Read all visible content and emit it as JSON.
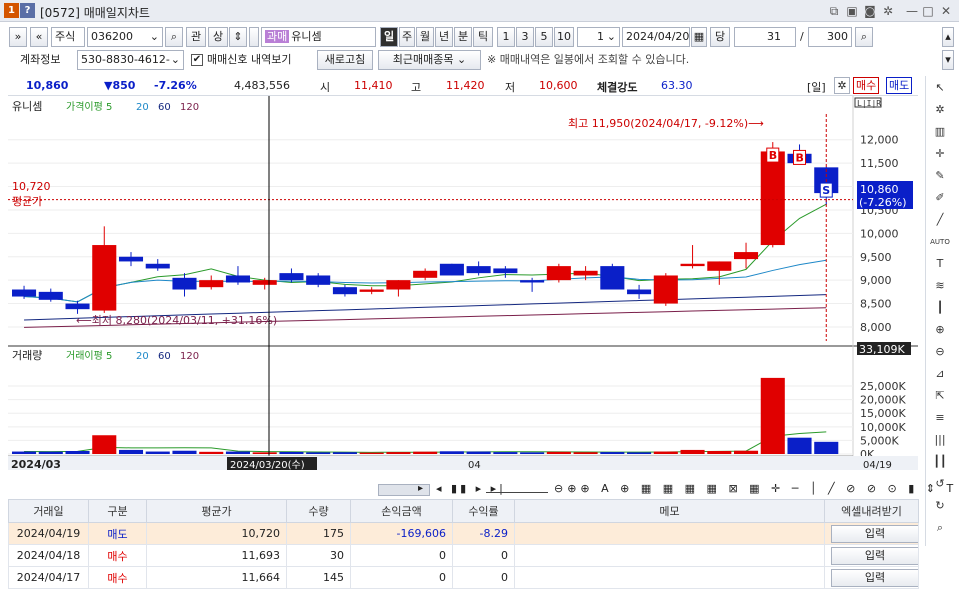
{
  "window": {
    "title": "[0572] 매매일지차트",
    "badge1": "1",
    "badge2": "?"
  },
  "toolbar": {
    "market": "주식",
    "code": "036200",
    "btn_search": "관",
    "btn_up": "상",
    "tax_tag": "과매",
    "stock_name": "유니셈",
    "periods": [
      "일",
      "주",
      "월",
      "년",
      "분",
      "틱"
    ],
    "nums": [
      "1",
      "3",
      "5",
      "10"
    ],
    "interval": "1",
    "date": "2024/04/20",
    "btn_today": "당",
    "count": "31",
    "slash": "/",
    "total": "300"
  },
  "account": {
    "label": "계좌정보",
    "number": "530-8830-4612-",
    "checkbox_label": "매매신호 내역보기",
    "refresh": "새로고침",
    "recent": "최근매매종목",
    "notice": "※ 매매내역은 일봉에서 조회할 수 있습니다."
  },
  "info": {
    "price": "10,860",
    "change": "▼850",
    "rate": "-7.26%",
    "volume": "4,483,556",
    "open_label": "시",
    "open": "11,410",
    "high_label": "고",
    "high": "11,420",
    "low_label": "저",
    "low": "10,600",
    "strength_label": "체결강도",
    "strength": "63.30",
    "period_tag": "[일]",
    "buy": "매수",
    "sell": "매도"
  },
  "legend": {
    "price": [
      "유니셈",
      "가격이평 5",
      "20",
      "60",
      "120"
    ],
    "volume": [
      "거래량",
      "거래이평 5",
      "20",
      "60",
      "120"
    ]
  },
  "annotations": {
    "high": "최고 11,950(2024/04/17, -9.12%)⟶",
    "low": "⟵최저 8,280(2024/03/11, +31.16%)",
    "avg_value": "10,720",
    "avg_label": "평균가",
    "cur_price": "10,860",
    "cur_rate": "(-7.26%)",
    "vol_max": "33,109K",
    "signal_buy": "B",
    "signal_sell": "S"
  },
  "colors": {
    "up": "#e00000",
    "down": "#0a1fc8",
    "ma5": "#2a9a2a",
    "ma20": "#1e88c8",
    "ma60": "#142880",
    "ma120": "#7a1f4a"
  },
  "chart_data": {
    "type": "candlestick",
    "price_axis": {
      "ticks": [
        "12,000",
        "11,500",
        "11,000",
        "10,500",
        "10,000",
        "9,500",
        "9,000",
        "8,500",
        "8,000"
      ],
      "ylim": [
        7700,
        12550
      ]
    },
    "volume_axis": {
      "ticks": [
        "25,000K",
        "20,000K",
        "15,000K",
        "10,000K",
        "5,000K",
        "0K"
      ],
      "ylim": [
        0,
        33109
      ]
    },
    "x_labels": [
      "2024/03",
      "04",
      "04/19"
    ],
    "crosshair_date": "2024/03/20(수)",
    "candles": [
      {
        "o": 8800,
        "h": 8880,
        "l": 8600,
        "c": 8650,
        "v": 900
      },
      {
        "o": 8750,
        "h": 8820,
        "l": 8540,
        "c": 8580,
        "v": 850
      },
      {
        "o": 8500,
        "h": 8560,
        "l": 8280,
        "c": 8380,
        "v": 1100
      },
      {
        "o": 8350,
        "h": 10150,
        "l": 8300,
        "c": 9750,
        "v": 6900
      },
      {
        "o": 9500,
        "h": 9600,
        "l": 9300,
        "c": 9400,
        "v": 1500
      },
      {
        "o": 9350,
        "h": 9450,
        "l": 9200,
        "c": 9250,
        "v": 900
      },
      {
        "o": 9050,
        "h": 9150,
        "l": 8650,
        "c": 8800,
        "v": 1200
      },
      {
        "o": 8850,
        "h": 9100,
        "l": 8800,
        "c": 9000,
        "v": 800
      },
      {
        "o": 9100,
        "h": 9300,
        "l": 8900,
        "c": 8950,
        "v": 900
      },
      {
        "o": 8900,
        "h": 9050,
        "l": 8800,
        "c": 9000,
        "v": 600
      },
      {
        "o": 9150,
        "h": 9250,
        "l": 8950,
        "c": 9000,
        "v": 750
      },
      {
        "o": 9100,
        "h": 9150,
        "l": 8850,
        "c": 8900,
        "v": 600
      },
      {
        "o": 8850,
        "h": 8900,
        "l": 8650,
        "c": 8700,
        "v": 650
      },
      {
        "o": 8750,
        "h": 8850,
        "l": 8700,
        "c": 8800,
        "v": 500
      },
      {
        "o": 8800,
        "h": 9000,
        "l": 8650,
        "c": 9000,
        "v": 700
      },
      {
        "o": 9050,
        "h": 9250,
        "l": 9000,
        "c": 9200,
        "v": 850
      },
      {
        "o": 9350,
        "h": 9350,
        "l": 9100,
        "c": 9100,
        "v": 1000
      },
      {
        "o": 9300,
        "h": 9400,
        "l": 9100,
        "c": 9150,
        "v": 900
      },
      {
        "o": 9250,
        "h": 9300,
        "l": 9050,
        "c": 9150,
        "v": 700
      },
      {
        "o": 9000,
        "h": 9050,
        "l": 8750,
        "c": 8950,
        "v": 600
      },
      {
        "o": 9000,
        "h": 9350,
        "l": 8950,
        "c": 9300,
        "v": 800
      },
      {
        "o": 9100,
        "h": 9300,
        "l": 9000,
        "c": 9200,
        "v": 650
      },
      {
        "o": 9300,
        "h": 9350,
        "l": 8850,
        "c": 8800,
        "v": 700
      },
      {
        "o": 8800,
        "h": 8900,
        "l": 8600,
        "c": 8700,
        "v": 600
      },
      {
        "o": 8500,
        "h": 9150,
        "l": 8450,
        "c": 9100,
        "v": 900
      },
      {
        "o": 9300,
        "h": 9750,
        "l": 9250,
        "c": 9350,
        "v": 1500
      },
      {
        "o": 9200,
        "h": 9400,
        "l": 8900,
        "c": 9400,
        "v": 1100
      },
      {
        "o": 9450,
        "h": 9800,
        "l": 9250,
        "c": 9600,
        "v": 1200
      },
      {
        "o": 9750,
        "h": 11950,
        "l": 9700,
        "c": 11750,
        "v": 28000
      },
      {
        "o": 11700,
        "h": 11900,
        "l": 11550,
        "c": 11500,
        "v": 6000
      },
      {
        "o": 11410,
        "h": 11420,
        "l": 10600,
        "c": 10860,
        "v": 4483
      }
    ],
    "trades": [
      {
        "date": "2024/04/17",
        "type": "매수",
        "avg": "11,664",
        "qty": "145",
        "pnl": "0",
        "rate": "0"
      },
      {
        "date": "2024/04/18",
        "type": "매수",
        "avg": "11,693",
        "qty": "30",
        "pnl": "0",
        "rate": "0"
      },
      {
        "date": "2024/04/19",
        "type": "매도",
        "avg": "10,720",
        "qty": "175",
        "pnl": "-169,606",
        "rate": "-8.29"
      }
    ]
  },
  "table": {
    "headers": [
      "거래일",
      "구분",
      "평균가",
      "수량",
      "손익금액",
      "수익률",
      "메모",
      "엑셀내려받기"
    ],
    "rows": [
      {
        "date": "2024/04/19",
        "type": "매도",
        "avg": "10,720",
        "qty": "175",
        "pnl": "-169,606",
        "rate": "-8.29",
        "memo": "",
        "action": "입력"
      },
      {
        "date": "2024/04/18",
        "type": "매수",
        "avg": "11,693",
        "qty": "30",
        "pnl": "0",
        "rate": "0",
        "memo": "",
        "action": "입력"
      },
      {
        "date": "2024/04/17",
        "type": "매수",
        "avg": "11,664",
        "qty": "145",
        "pnl": "0",
        "rate": "0",
        "memo": "",
        "action": "입력"
      }
    ]
  }
}
